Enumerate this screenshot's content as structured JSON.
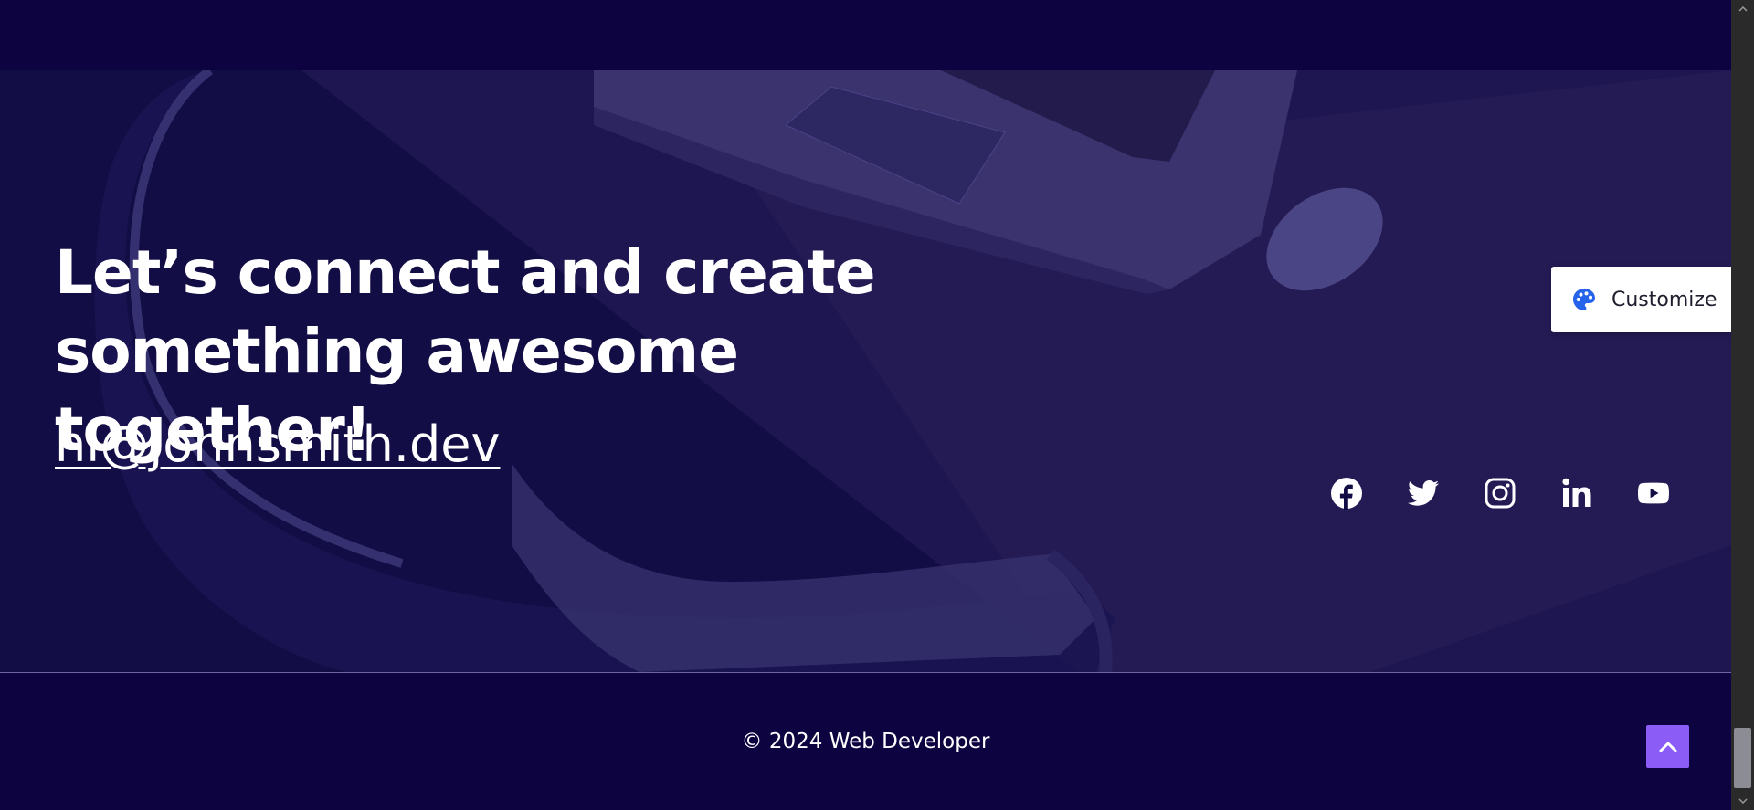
{
  "hero": {
    "headline_line1": "Let’s connect and create",
    "headline_line2": "something awesome together!",
    "email": "hi@johnsmith.dev"
  },
  "socials": [
    {
      "name": "facebook-icon"
    },
    {
      "name": "twitter-icon"
    },
    {
      "name": "instagram-icon"
    },
    {
      "name": "linkedin-icon"
    },
    {
      "name": "youtube-icon"
    }
  ],
  "customize": {
    "label": "Customize",
    "icon": "palette-icon",
    "icon_color": "#2563eb"
  },
  "footer": {
    "copyright": "© 2024 Web Developer"
  },
  "back_to_top": {
    "icon": "chevron-up-icon",
    "color": "#8b5cf6"
  },
  "colors": {
    "background": "#0c0340",
    "hero_overlay": "#15104a",
    "text": "#ffffff"
  }
}
